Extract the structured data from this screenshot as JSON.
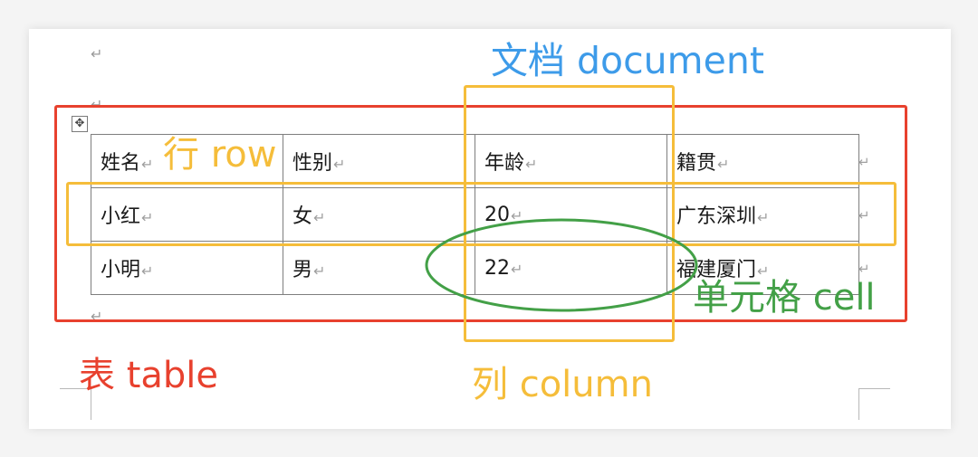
{
  "paragraph_mark": "↵",
  "row_end_mark": "↵",
  "move_handle_icon": "✥",
  "table": {
    "rows": [
      [
        "姓名",
        "性别",
        "年龄",
        "籍贯"
      ],
      [
        "小红",
        "女",
        "20",
        "广东深圳"
      ],
      [
        "小明",
        "男",
        "22",
        "福建厦门"
      ]
    ]
  },
  "annotations": {
    "document": "文档 document",
    "row": "行 row",
    "cell": "单元格 cell",
    "table": "表 table",
    "column": "列 column"
  },
  "colors": {
    "table": "#e8412e",
    "document": "#3d9be9",
    "row_column": "#f5bd3a",
    "cell": "#43a047"
  }
}
